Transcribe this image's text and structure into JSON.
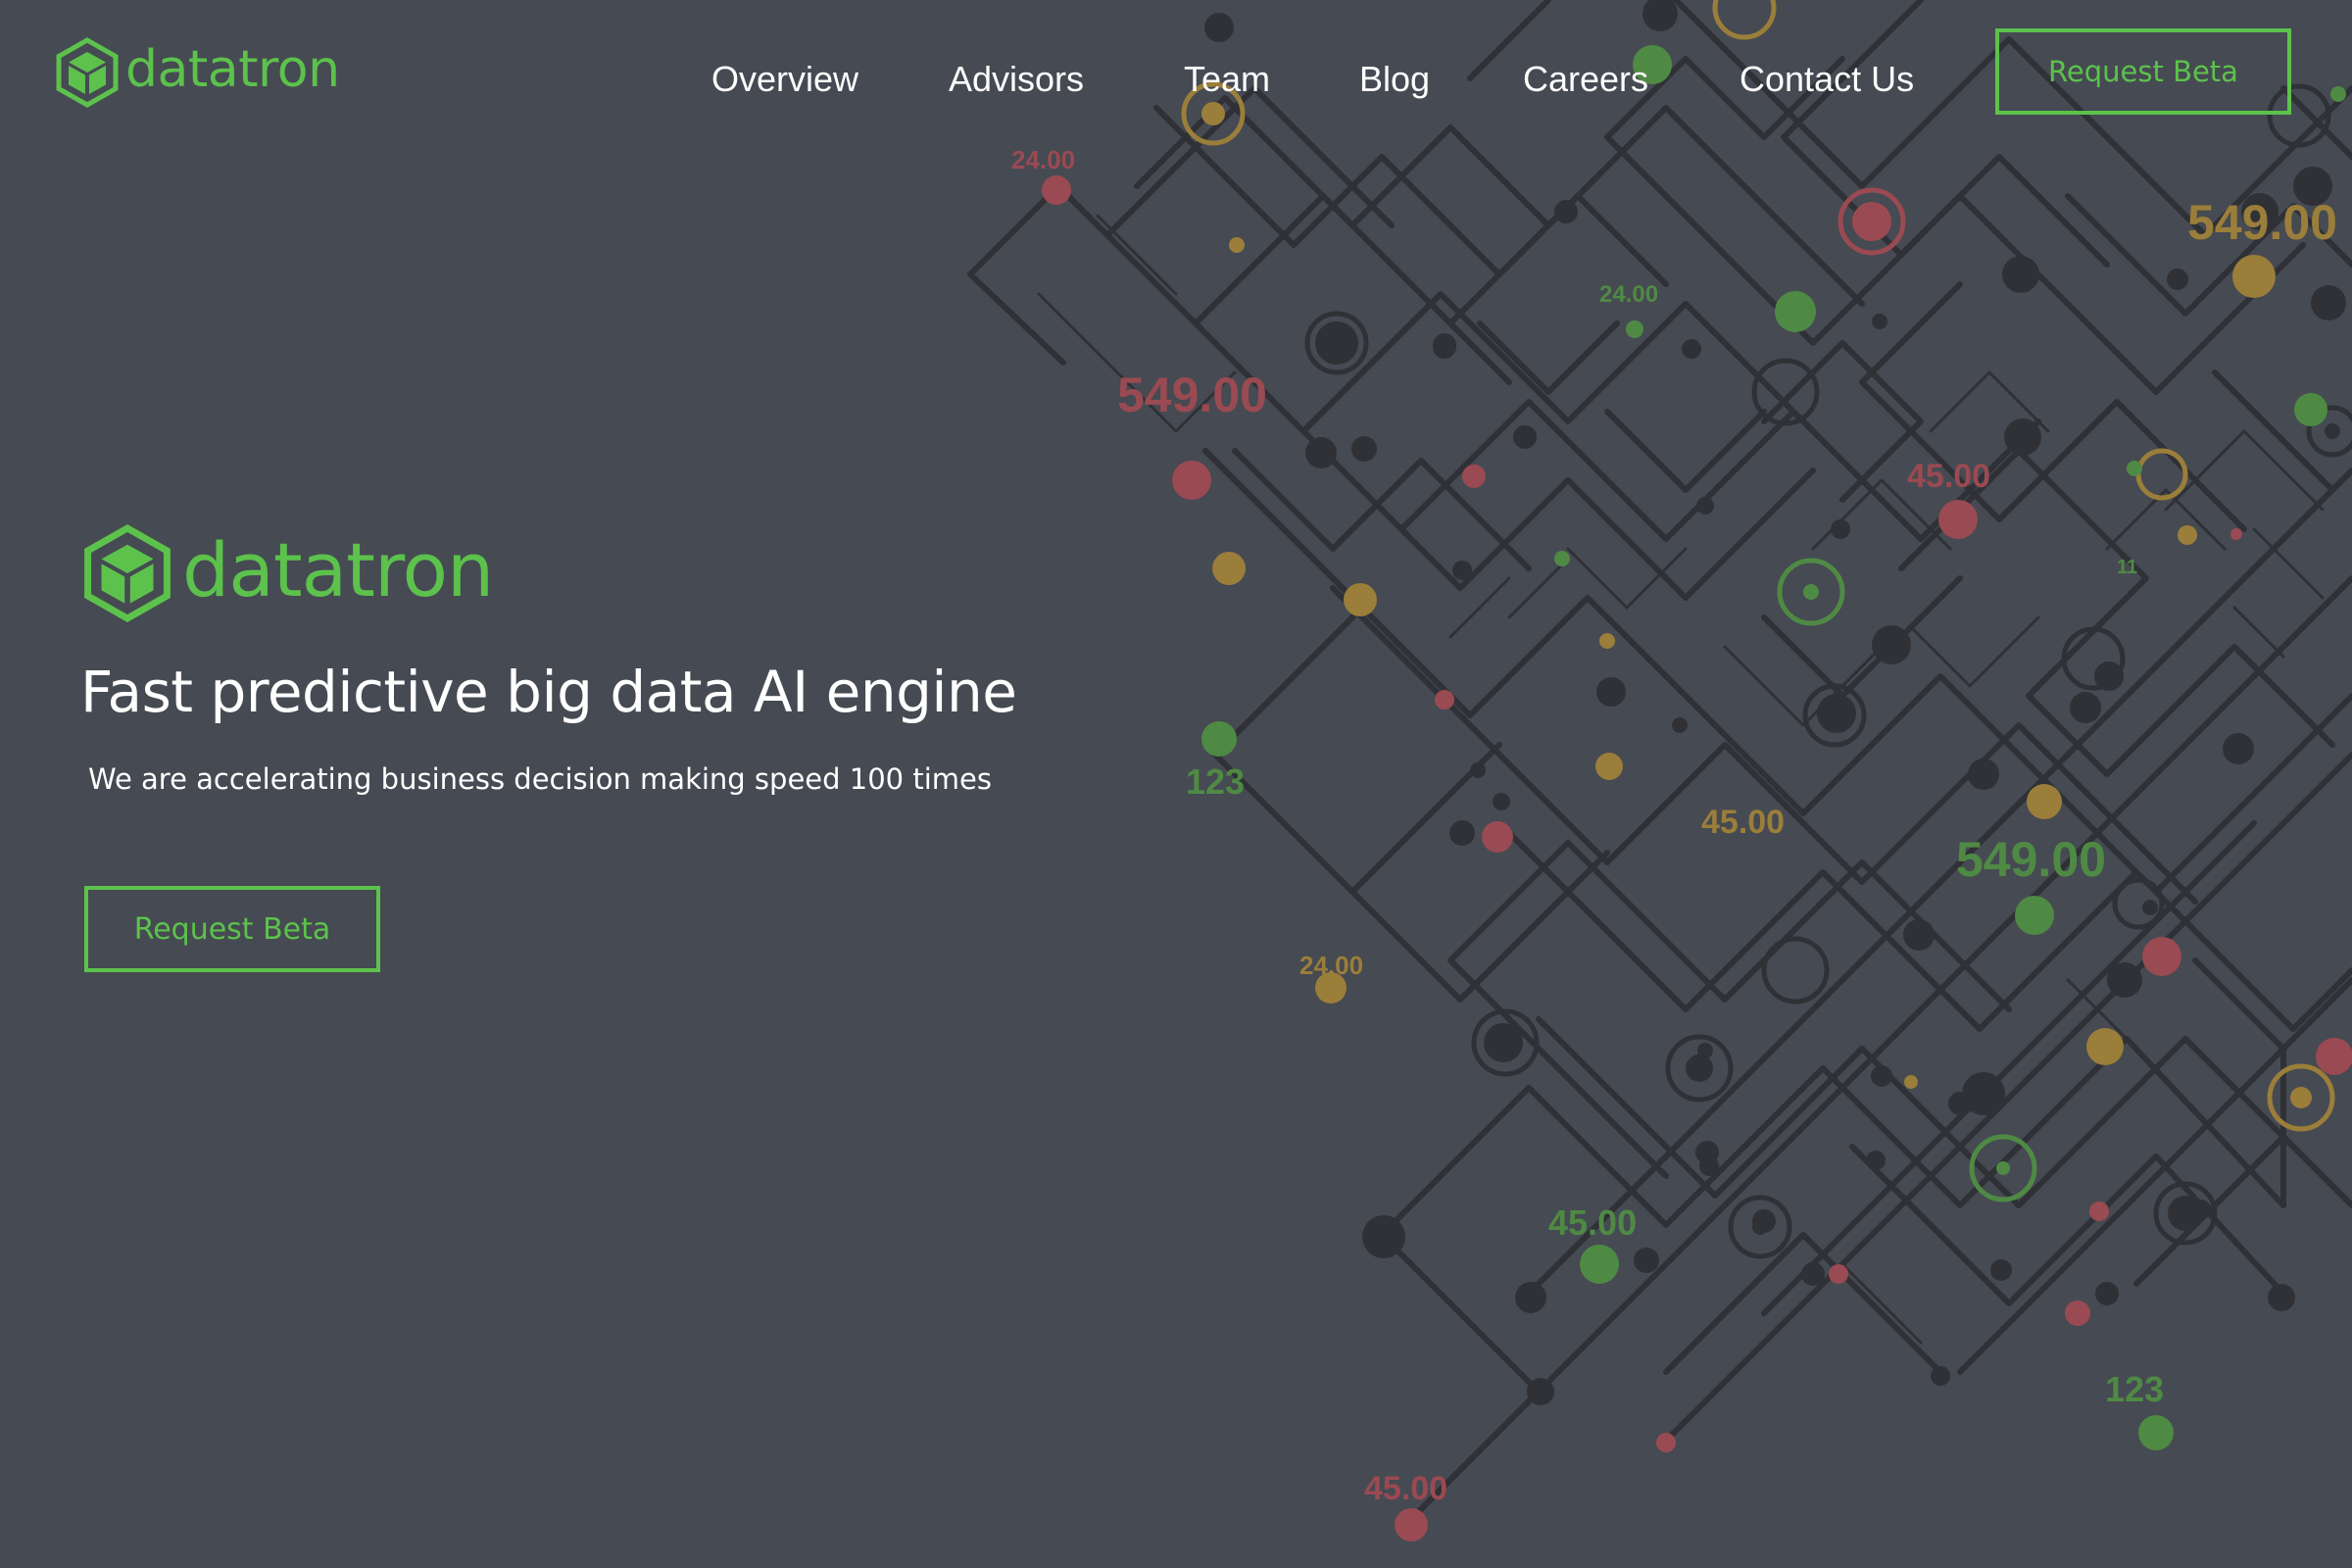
{
  "brand": {
    "name": "datatron",
    "accent_color": "#5cc24c",
    "logo_icon": "hexagon-cube-icon"
  },
  "nav": {
    "items": [
      {
        "label": "Overview"
      },
      {
        "label": "Advisors"
      },
      {
        "label": "Team"
      },
      {
        "label": "Blog"
      },
      {
        "label": "Careers"
      },
      {
        "label": "Contact Us"
      }
    ],
    "cta_label": "Request Beta"
  },
  "hero": {
    "brand_name": "datatron",
    "headline": "Fast predictive big data AI engine",
    "subheadline": "We are accelerating business decision making speed 100 times",
    "cta_label": "Request Beta"
  },
  "background": {
    "colors": {
      "page": "#464a52",
      "lines": "#2f3136",
      "red": "#9a4a52",
      "gold": "#9a7e3a",
      "green": "#4f8a44"
    },
    "labels": [
      {
        "text": "24.00",
        "color": "red"
      },
      {
        "text": "549.00",
        "color": "red"
      },
      {
        "text": "123",
        "color": "green"
      },
      {
        "text": "24.00",
        "color": "green"
      },
      {
        "text": "45.00",
        "color": "red"
      },
      {
        "text": "11",
        "color": "green"
      },
      {
        "text": "549.00",
        "color": "gold"
      },
      {
        "text": "45.00",
        "color": "gold"
      },
      {
        "text": "549.00",
        "color": "green"
      },
      {
        "text": "24.00",
        "color": "gold"
      },
      {
        "text": "45.00",
        "color": "green"
      },
      {
        "text": "123",
        "color": "green"
      },
      {
        "text": "45.00",
        "color": "red"
      }
    ]
  }
}
